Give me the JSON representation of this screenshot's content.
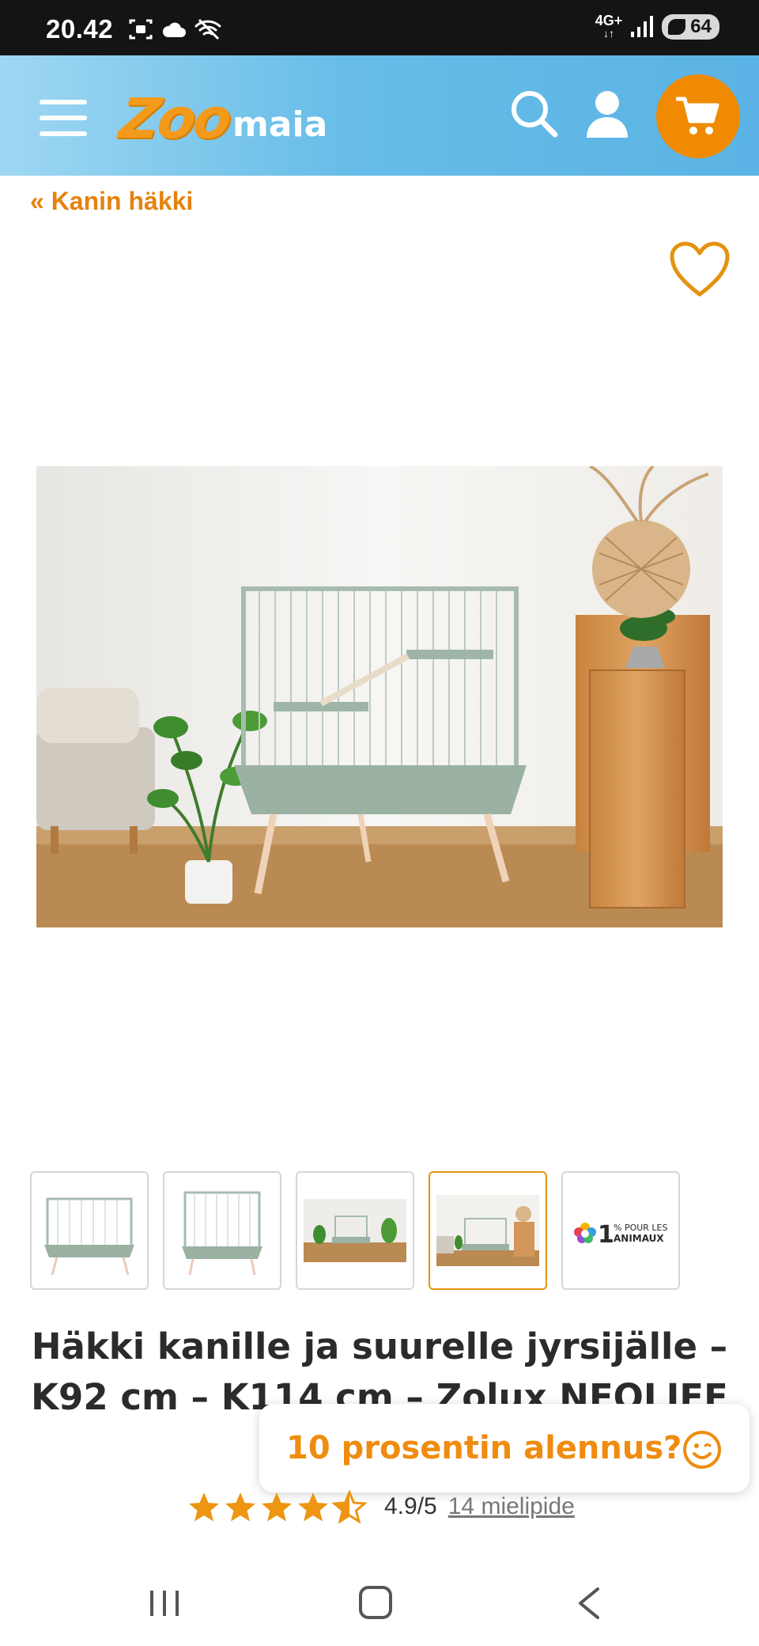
{
  "status_bar": {
    "time": "20.42",
    "network": "4G+",
    "battery": "64"
  },
  "header": {
    "logo_zoo": "Zoo",
    "logo_maia": "maia"
  },
  "breadcrumb": {
    "label": "« Kanin häkki"
  },
  "product": {
    "title": "Häkki kanille ja suurelle jyrsijälle – K92 cm – K114 cm – Zolux NEOLIFE",
    "rating_score": "4.9/5",
    "reviews_count": "14",
    "reviews_label": "mielipide",
    "stars_full": 4,
    "stars_half": 1
  },
  "thumbnails": [
    {
      "name": "cage-front",
      "active": false
    },
    {
      "name": "cage-angle",
      "active": false
    },
    {
      "name": "room-wide",
      "active": false
    },
    {
      "name": "room-living",
      "active": true
    },
    {
      "name": "one-percent-logo",
      "active": false,
      "logo_text_1": "1",
      "logo_text_2": "% POUR LES",
      "logo_text_3": "ANIMAUX"
    }
  ],
  "discount_popup": {
    "text": "10 prosentin alennus?"
  },
  "colors": {
    "accent": "#f08a00",
    "header_blue": "#5ab3e4",
    "title": "#2b2b2b"
  }
}
